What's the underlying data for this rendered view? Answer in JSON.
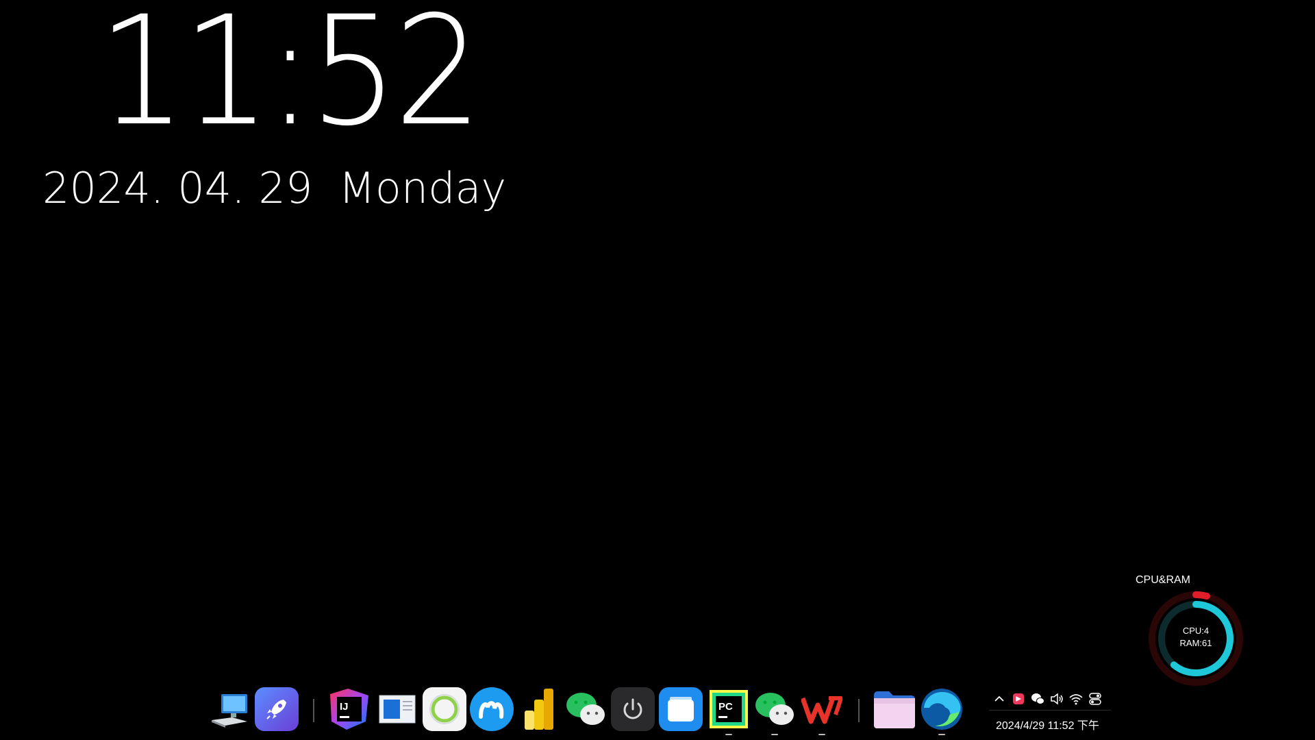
{
  "clock": {
    "time": "11:52",
    "date": "2024. 04. 29",
    "weekday": "Monday"
  },
  "widget": {
    "title": "CPU&RAM",
    "cpu_label": "CPU:4",
    "ram_label": "RAM:61",
    "cpu_percent": 4,
    "ram_percent": 61,
    "cpu_color": "#e11d2a",
    "ram_color": "#1ec8d9"
  },
  "dock": {
    "items": [
      {
        "name": "this-pc",
        "icon": "computer-icon"
      },
      {
        "name": "launcher",
        "icon": "rocket-icon"
      },
      {
        "name": "intellij-idea",
        "icon": "intellij-icon",
        "text": "IJ"
      },
      {
        "name": "window-app",
        "icon": "window-icon"
      },
      {
        "name": "circle-app",
        "icon": "ring-icon"
      },
      {
        "name": "blue-app",
        "icon": "m-logo-icon"
      },
      {
        "name": "power-bi",
        "icon": "power-bi-icon"
      },
      {
        "name": "wechat",
        "icon": "wechat-icon"
      },
      {
        "name": "power",
        "icon": "power-icon"
      },
      {
        "name": "files",
        "icon": "files-icon"
      },
      {
        "name": "pycharm",
        "icon": "pycharm-icon",
        "text": "PC"
      },
      {
        "name": "wechat-2",
        "icon": "wechat-icon"
      },
      {
        "name": "wps-office",
        "icon": "wps-icon"
      },
      {
        "name": "file-explorer",
        "icon": "folder-icon"
      },
      {
        "name": "edge",
        "icon": "edge-icon"
      }
    ]
  },
  "tray": {
    "datetime": "2024/4/29 11:52 下午",
    "icons": [
      "chevron-up-icon",
      "app-icon",
      "wechat-icon",
      "volume-icon",
      "wifi-icon",
      "toggle-icon"
    ]
  }
}
